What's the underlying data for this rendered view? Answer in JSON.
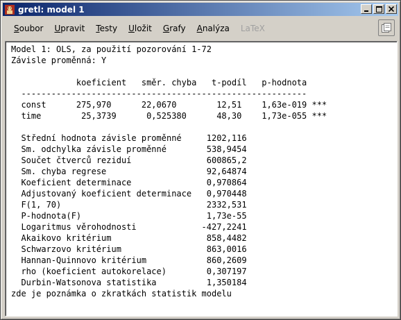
{
  "window": {
    "title": "gretl: model 1"
  },
  "menu": [
    {
      "pre": "",
      "u": "S",
      "post": "oubor",
      "disabled": false
    },
    {
      "pre": "",
      "u": "U",
      "post": "pravit",
      "disabled": false
    },
    {
      "pre": "",
      "u": "T",
      "post": "esty",
      "disabled": false
    },
    {
      "pre": "",
      "u": "U",
      "post": "ložit",
      "disabled": false
    },
    {
      "pre": "",
      "u": "G",
      "post": "rafy",
      "disabled": false
    },
    {
      "pre": "",
      "u": "A",
      "post": "nalýza",
      "disabled": false
    },
    {
      "pre": "",
      "u": "",
      "post": "LaTeX",
      "disabled": true
    }
  ],
  "output": {
    "lines": [
      "Model 1: OLS, za použití pozorování 1-72",
      "Závisle proměnná: Y",
      "",
      "             koeficient   směr. chyba   t-podíl   p-hodnota",
      "  ---------------------------------------------------------",
      "  const      275,970      22,0670        12,51    1,63e-019 ***",
      "  time        25,3739      0,525380      48,30    1,73e-055 ***",
      "",
      "  Střední hodnota závisle proměnné     1202,116",
      "  Sm. odchylka závisle proměnné        538,9454",
      "  Součet čtverců reziduí               600865,2",
      "  Sm. chyba regrese                    92,64874",
      "  Koeficient determinace               0,970864",
      "  Adjustovaný koeficient determinace   0,970448",
      "  F(1, 70)                             2332,531",
      "  P-hodnota(F)                         1,73e-55",
      "  Logaritmus věrohodnosti             -427,2241",
      "  Akaikovo kritérium                   858,4482",
      "  Schwarzovo kritérium                 863,0016",
      "  Hannan-Quinnovo kritérium            860,2609",
      "  rho (koeficient autokorelace)        0,307197",
      "  Durbin-Watsonova statistika          1,350184",
      "zde je poznámka o zkratkách statistik modelu"
    ]
  },
  "icons": {
    "app": "gretl-app-icon",
    "minimize": "minimize-icon",
    "maximize": "maximize-icon",
    "close": "close-icon",
    "copy": "copy-icon"
  }
}
